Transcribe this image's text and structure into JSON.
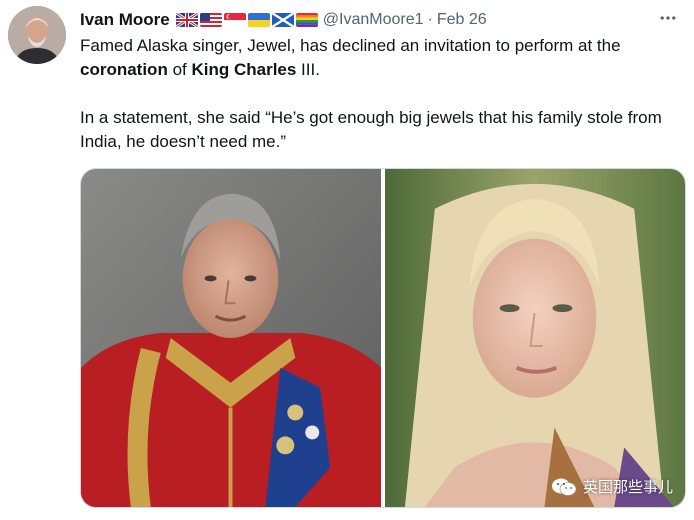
{
  "tweet": {
    "author_name": "Ivan Moore",
    "handle": "@IvanMoore1",
    "separator": "·",
    "date": "Feb 26",
    "flags": [
      "uk-flag",
      "us-flag",
      "singapore-flag",
      "ukraine-flag",
      "scotland-flag",
      "rainbow-flag"
    ],
    "text_line1_a": "Famed Alaska singer, Jewel, has declined an invitation to perform at the ",
    "text_line1_b": "coronation",
    "text_line1_c": " of ",
    "text_line1_d": "King Charles",
    "text_line1_e": " III.",
    "text_para2": "In a statement, she said “He’s got enough big jewels that his family stole from India, he doesn’t need me.”",
    "more_icon": "more-horizontal-icon"
  },
  "media": {
    "left_image": "portrait-man-in-red-military-uniform",
    "right_image": "portrait-blonde-woman"
  },
  "watermark": {
    "text": "英国那些事儿",
    "icon": "wechat-icon"
  }
}
